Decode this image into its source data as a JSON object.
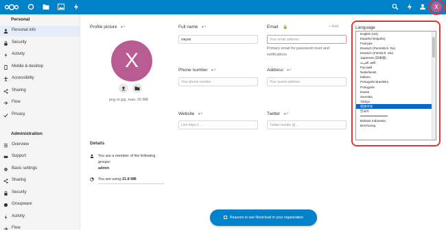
{
  "topbar": {
    "avatar_initial": "X",
    "colors": {
      "bar": "#0082c9",
      "avatar": "#b85c93",
      "highlight_ring": "#e23232"
    },
    "app_icons": [
      "nextcloud-logo-icon",
      "dashboard-icon",
      "files-icon",
      "photos-icon",
      "activity-icon"
    ],
    "right_icons": [
      "search-icon",
      "notifications-icon",
      "contacts-icon"
    ]
  },
  "sidebar": {
    "personal_caption": "Personal",
    "personal_items": [
      {
        "label": "Personal info",
        "icon": "person-icon",
        "active": true
      },
      {
        "label": "Security",
        "icon": "lock-icon"
      },
      {
        "label": "Activity",
        "icon": "activity-icon"
      },
      {
        "label": "Mobile & desktop",
        "icon": "phone-icon"
      },
      {
        "label": "Accessibility",
        "icon": "accessibility-icon"
      },
      {
        "label": "Sharing",
        "icon": "share-icon"
      },
      {
        "label": "Flow",
        "icon": "flow-icon"
      },
      {
        "label": "Privacy",
        "icon": "check-icon"
      }
    ],
    "admin_caption": "Administration",
    "admin_items": [
      {
        "label": "Overview",
        "icon": "list-icon"
      },
      {
        "label": "Support",
        "icon": "support-icon"
      },
      {
        "label": "Basic settings",
        "icon": "gear-icon"
      },
      {
        "label": "Sharing",
        "icon": "share-icon"
      },
      {
        "label": "Security",
        "icon": "lock-icon"
      },
      {
        "label": "Groupware",
        "icon": "groupware-icon"
      },
      {
        "label": "Activity",
        "icon": "activity-icon"
      },
      {
        "label": "Flow",
        "icon": "flow-icon"
      }
    ]
  },
  "profile": {
    "title": "Profile picture",
    "avatar_initial": "X",
    "hint": "png or jpg, max. 20 MB"
  },
  "fullname": {
    "title": "Full name",
    "value": "xiayan"
  },
  "email": {
    "title": "Email",
    "add_label": "+ Add",
    "placeholder": "Your email address",
    "hint": "Primary email for password reset and notifications"
  },
  "phone": {
    "title": "Phone number",
    "placeholder": "Your phone number"
  },
  "address": {
    "title": "Address",
    "placeholder": "Your postal address"
  },
  "website": {
    "title": "Website",
    "placeholder": "Link https://..."
  },
  "twitter": {
    "title": "Twitter",
    "placeholder": "Twitter handle @..."
  },
  "language": {
    "title": "Language",
    "options": [
      "English (US)",
      "Español (España)",
      "Français",
      "Deutsch (Persönlich: Du)",
      "Deutsch (Förmlich: Sie)",
      "Japanese (日本語)",
      "اللغة العربية",
      "Русский",
      "Nederlands",
      "Italiano",
      "Português Brasileiro",
      "Português",
      "Dansk",
      "Svenska",
      "Türkçe",
      "简体中文",
      "한국어",
      "",
      "Bahasa Indonesia",
      "Brezhoneg"
    ],
    "selected": "简体中文"
  },
  "details": {
    "title": "Details",
    "groups_text": "You are a member of the following groups:",
    "group": "admin",
    "usage_prefix": "You are using",
    "usage_value": "21.8 MB"
  },
  "banner": {
    "label": "Reasons to use Nextcloud in your organization"
  }
}
